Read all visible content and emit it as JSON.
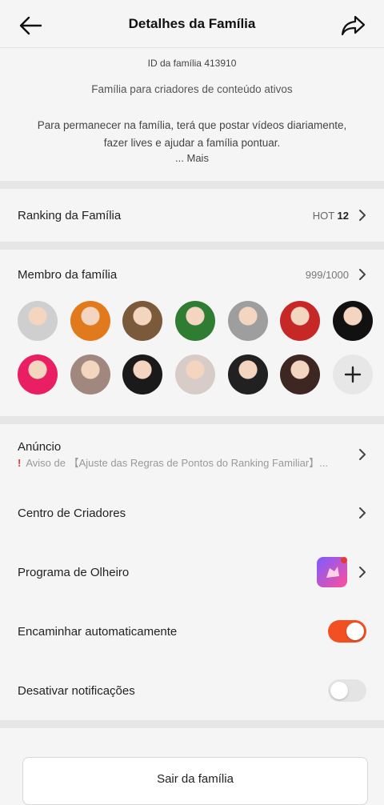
{
  "header": {
    "title": "Detalhes da Família",
    "back_icon": "arrow-left-icon",
    "share_icon": "share-arrow-icon"
  },
  "intro": {
    "family_id": "ID da família 413910",
    "slogan": "Família para criadores de conteúdo ativos",
    "description": "Para permanecer na família, terá que postar vídeos diariamente, fazer lives e ajudar a família pontuar.",
    "more": "... Mais"
  },
  "ranking": {
    "label": "Ranking da Família",
    "hot_label": "HOT",
    "hot_value": "12"
  },
  "members": {
    "label": "Membro da família",
    "count": "999/1000",
    "avatar_colors": [
      "#cfcfcf",
      "#e07a1c",
      "#7a5a3a",
      "#2e7d32",
      "#9e9e9e",
      "#c62828",
      "#111111",
      "#e91e63",
      "#a1887f",
      "#1a1a1a",
      "#d7ccc8",
      "#212121",
      "#3e2723"
    ],
    "add_icon": "plus-icon"
  },
  "announcement": {
    "label": "Anúncio",
    "text": "Aviso de 【Ajuste das Regras de Pontos do Ranking Familiar】..."
  },
  "creators": {
    "label": "Centro de Criadores"
  },
  "scout": {
    "label": "Programa de Olheiro"
  },
  "auto_forward": {
    "label": "Encaminhar automaticamente",
    "on": true
  },
  "notifications": {
    "label": "Desativar notificações",
    "on": false
  },
  "leave": {
    "label": "Sair da família"
  },
  "colors": {
    "accent": "#f25022",
    "separator": "#e6e6e6",
    "background": "#f5f5f5"
  }
}
